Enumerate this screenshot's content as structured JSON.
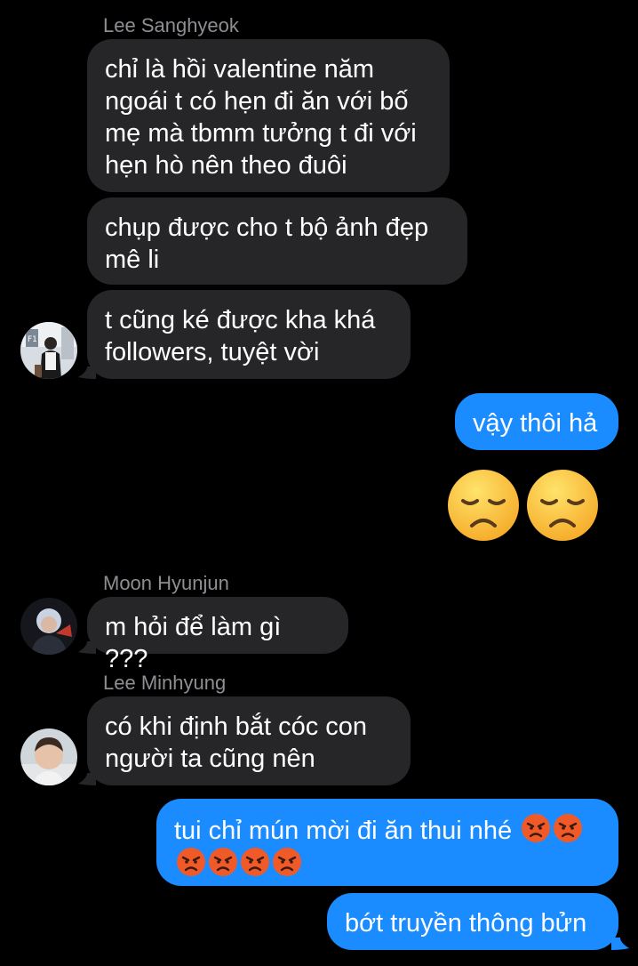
{
  "thread": {
    "group1": {
      "sender": "Lee Sanghyeok",
      "messages": [
        "chỉ là hồi valentine năm\nngoái t có hẹn đi ăn với bố\nmẹ mà tbmm tưởng t đi với\nhẹn hò nên theo đuôi",
        "chụp được cho t bộ ảnh đẹp\nmê li",
        "t cũng ké được kha khá\nfollowers, tuyệt vời"
      ],
      "avatar_icon": "user-photo-avatar"
    },
    "outgoing1": {
      "text": "vậy thôi hả",
      "emoji": [
        "disappointed-face",
        "disappointed-face"
      ]
    },
    "group2": {
      "sender": "Moon Hyunjun",
      "message": "m hỏi để làm gì ???",
      "avatar_icon": "user-photo-avatar"
    },
    "group3": {
      "sender": "Lee Minhyung",
      "message": "có khi định bắt cóc con\nngười ta cũng nên",
      "avatar_icon": "user-photo-avatar"
    },
    "outgoing2": {
      "text_line1": "tui chỉ mún mời đi ăn thui nhé ",
      "angry_count_line1": 2,
      "angry_count_line2": 4,
      "reply": "bớt truyền thông bửn"
    }
  },
  "colors": {
    "background": "#000000",
    "incoming_bubble": "#262628",
    "outgoing_bubble": "#1a8cff",
    "sender_name": "#8e8e93"
  }
}
